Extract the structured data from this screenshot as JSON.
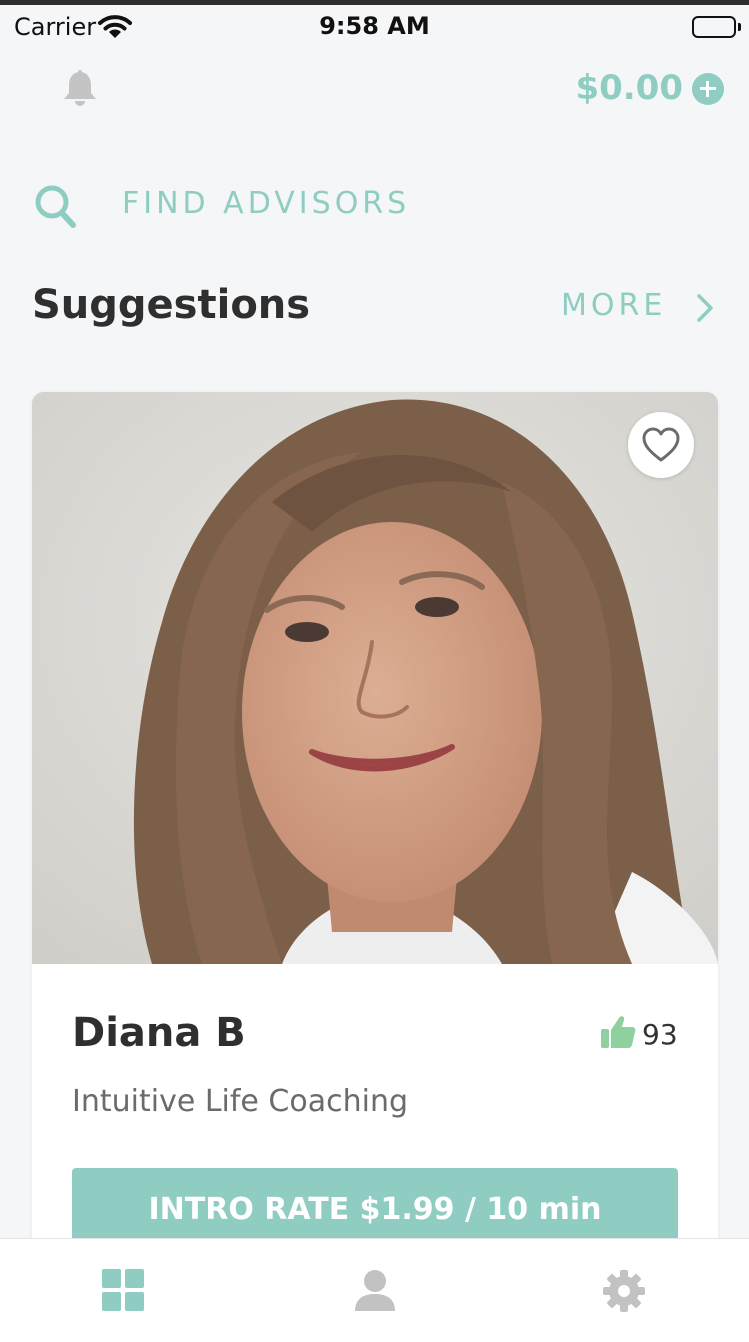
{
  "status_bar": {
    "carrier": "Carrier",
    "time": "9:58 AM"
  },
  "header": {
    "notifications_icon": "bell-icon",
    "balance": "$0.00",
    "add_funds_icon": "plus-circle-icon"
  },
  "search": {
    "icon": "search-icon",
    "label": "FIND ADVISORS"
  },
  "suggestions": {
    "title": "Suggestions",
    "more_label": "MORE",
    "more_icon": "chevron-right-icon"
  },
  "advisor_card": {
    "favorite_icon": "heart-outline-icon",
    "name": "Diana B",
    "likes_icon": "thumbs-up-icon",
    "likes": "93",
    "specialty": "Intuitive Life Coaching",
    "rate_button": "INTRO RATE $1.99 / 10 min"
  },
  "tab_bar": {
    "tabs": [
      {
        "icon": "grid-icon",
        "active": true
      },
      {
        "icon": "person-icon",
        "active": false
      },
      {
        "icon": "gear-icon",
        "active": false
      }
    ]
  },
  "colors": {
    "accent": "#8fcdc3",
    "background": "#f4f6f8",
    "text_dark": "#2f2f2f",
    "text_muted": "#6b6b6b",
    "icon_inactive": "#c2c2c2",
    "like_green": "#8fd19e"
  }
}
